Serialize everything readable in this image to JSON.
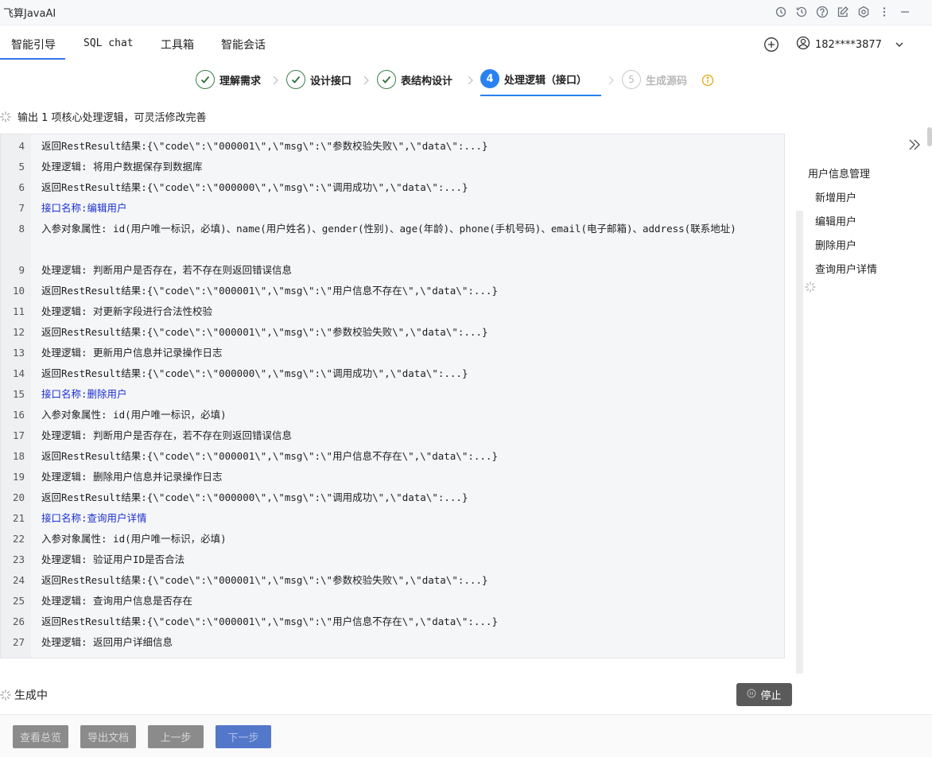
{
  "app": {
    "title": "飞算JavaAI"
  },
  "tabs": [
    {
      "label": "智能引导"
    },
    {
      "label": "SQL chat"
    },
    {
      "label": "工具箱"
    },
    {
      "label": "智能会话"
    }
  ],
  "user": {
    "name": "182****3877"
  },
  "steps": [
    {
      "label": "理解需求",
      "state": "done"
    },
    {
      "label": "设计接口",
      "state": "done"
    },
    {
      "label": "表结构设计",
      "state": "done"
    },
    {
      "number": "4",
      "label": "处理逻辑（接口）",
      "state": "active"
    },
    {
      "number": "5",
      "label": "生成源码",
      "state": "pending"
    }
  ],
  "output_message": "输出 1 项核心处理逻辑，可灵活修改完善",
  "code_lines": [
    {
      "num": "4",
      "text": "返回RestResult结果:{\\\"code\\\":\\\"000001\\\",\\\"msg\\\":\\\"参数校验失败\\\",\\\"data\\\":...}"
    },
    {
      "num": "5",
      "text": "处理逻辑: 将用户数据保存到数据库"
    },
    {
      "num": "6",
      "text": "返回RestResult结果:{\\\"code\\\":\\\"000000\\\",\\\"msg\\\":\\\"调用成功\\\",\\\"data\\\":...}"
    },
    {
      "num": "7",
      "text": "接口名称:编辑用户"
    },
    {
      "num": "8",
      "text": "入参对象属性: id(用户唯一标识，必填)、name(用户姓名)、gender(性别)、age(年龄)、phone(手机号码)、email(电子邮箱)、address(联系地址)"
    },
    {
      "num": "9",
      "text": "处理逻辑: 判断用户是否存在，若不存在则返回错误信息"
    },
    {
      "num": "10",
      "text": "返回RestResult结果:{\\\"code\\\":\\\"000001\\\",\\\"msg\\\":\\\"用户信息不存在\\\",\\\"data\\\":...}"
    },
    {
      "num": "11",
      "text": "处理逻辑: 对更新字段进行合法性校验"
    },
    {
      "num": "12",
      "text": "返回RestResult结果:{\\\"code\\\":\\\"000001\\\",\\\"msg\\\":\\\"参数校验失败\\\",\\\"data\\\":...}"
    },
    {
      "num": "13",
      "text": "处理逻辑: 更新用户信息并记录操作日志"
    },
    {
      "num": "14",
      "text": "返回RestResult结果:{\\\"code\\\":\\\"000000\\\",\\\"msg\\\":\\\"调用成功\\\",\\\"data\\\":...}"
    },
    {
      "num": "15",
      "text": "接口名称:删除用户"
    },
    {
      "num": "16",
      "text": "入参对象属性: id(用户唯一标识，必填)"
    },
    {
      "num": "17",
      "text": "处理逻辑: 判断用户是否存在，若不存在则返回错误信息"
    },
    {
      "num": "18",
      "text": "返回RestResult结果:{\\\"code\\\":\\\"000001\\\",\\\"msg\\\":\\\"用户信息不存在\\\",\\\"data\\\":...}"
    },
    {
      "num": "19",
      "text": "处理逻辑: 删除用户信息并记录操作日志"
    },
    {
      "num": "20",
      "text": "返回RestResult结果:{\\\"code\\\":\\\"000000\\\",\\\"msg\\\":\\\"调用成功\\\",\\\"data\\\":...}"
    },
    {
      "num": "21",
      "text": "接口名称:查询用户详情"
    },
    {
      "num": "22",
      "text": "入参对象属性: id(用户唯一标识，必填)"
    },
    {
      "num": "23",
      "text": "处理逻辑: 验证用户ID是否合法"
    },
    {
      "num": "24",
      "text": "返回RestResult结果:{\\\"code\\\":\\\"000001\\\",\\\"msg\\\":\\\"参数校验失败\\\",\\\"data\\\":...}"
    },
    {
      "num": "25",
      "text": "处理逻辑: 查询用户信息是否存在"
    },
    {
      "num": "26",
      "text": "返回RestResult结果:{\\\"code\\\":\\\"000001\\\",\\\"msg\\\":\\\"用户信息不存在\\\",\\\"data\\\":...}"
    },
    {
      "num": "27",
      "text": "处理逻辑: 返回用户详细信息"
    }
  ],
  "outline": {
    "title": "用户信息管理",
    "items": [
      {
        "label": "新增用户"
      },
      {
        "label": "编辑用户"
      },
      {
        "label": "删除用户"
      },
      {
        "label": "查询用户详情"
      }
    ]
  },
  "status": {
    "generating": "生成中",
    "stop_label": "停止"
  },
  "footer": {
    "overview": "查看总览",
    "export": "导出文档",
    "prev": "上一步",
    "next": "下一步"
  },
  "colors": {
    "accent": "#2a82f0",
    "done_check": "#3a7f4a",
    "interface_name": "#1a2fcf"
  },
  "icons": [
    "settings-spark-icon",
    "history-icon",
    "help-icon",
    "edit-icon",
    "gear-icon",
    "more-icon",
    "minimize-icon",
    "add-circle-icon",
    "user-icon",
    "chevron-down-icon",
    "check-icon",
    "chevron-right-icon",
    "info-icon",
    "loading-icon",
    "collapse-panel-icon",
    "pause-icon"
  ]
}
